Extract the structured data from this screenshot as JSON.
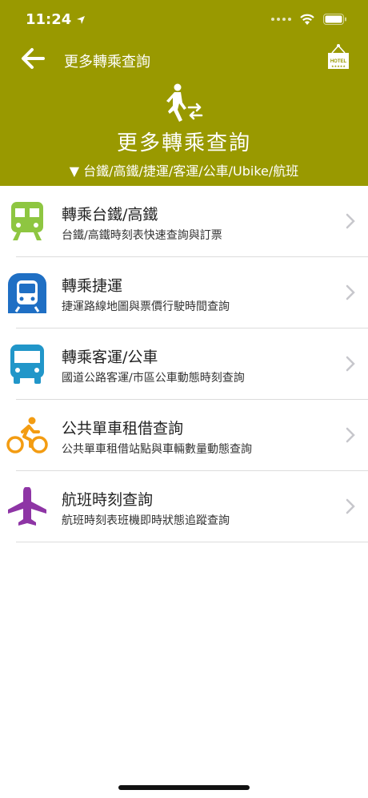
{
  "status": {
    "time": "11:24"
  },
  "nav": {
    "title": "更多轉乘查詢"
  },
  "hero": {
    "title": "更多轉乘查詢",
    "subtitle": "▼ 台鐵/高鐵/捷運/客運/公車/Ubike/航班"
  },
  "hotel_icon_text": "HOTEL",
  "colors": {
    "header_bg": "#999900",
    "train": "#8ec641",
    "metro": "#1f6fc4",
    "bus": "#2196c9",
    "bike": "#f39c12",
    "flight": "#8e35a5"
  },
  "items": [
    {
      "icon": "train-icon",
      "title": "轉乘台鐵/高鐵",
      "desc": "台鐵/高鐵時刻表快速查詢與訂票"
    },
    {
      "icon": "metro-icon",
      "title": "轉乘捷運",
      "desc": "捷運路線地圖與票價行駛時間查詢"
    },
    {
      "icon": "bus-icon",
      "title": "轉乘客運/公車",
      "desc": "國道公路客運/市區公車動態時刻查詢"
    },
    {
      "icon": "bike-icon",
      "title": "公共單車租借查詢",
      "desc": "公共單車租借站點與車輛數量動態查詢"
    },
    {
      "icon": "airplane-icon",
      "title": "航班時刻查詢",
      "desc": "航班時刻表班機即時狀態追蹤查詢"
    }
  ]
}
